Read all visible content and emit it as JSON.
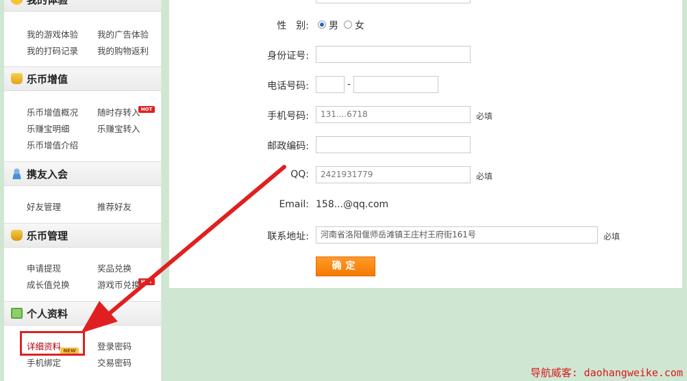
{
  "sidebar": {
    "sections": [
      {
        "title": "我的体验",
        "links": [
          "我的游戏体验",
          "我的广告体验",
          "我的打码记录",
          "我的购物返利"
        ]
      },
      {
        "title": "乐币增值",
        "links": [
          "乐币增值概况",
          "随时存转入",
          "乐赚宝明细",
          "乐赚宝转入",
          "乐币增值介绍"
        ]
      },
      {
        "title": "携友入会",
        "links": [
          "好友管理",
          "推荐好友"
        ]
      },
      {
        "title": "乐币管理",
        "links": [
          "申请提现",
          "奖品兑换",
          "成长值兑换",
          "游戏币兑换"
        ]
      },
      {
        "title": "个人资料",
        "links": [
          "详细资料",
          "登录密码",
          "手机绑定",
          "交易密码"
        ]
      }
    ],
    "hot_badge": "HOT",
    "new_badge": "NEW"
  },
  "form": {
    "gender_label": "性　别:",
    "gender_male": "男",
    "gender_female": "女",
    "gender_selected": "男",
    "id_label": "身份证号:",
    "id_value": "",
    "tel_label": "电话号码:",
    "tel_separator": "-",
    "mobile_label": "手机号码:",
    "mobile_value": "131....6718",
    "mobile_note": "必填",
    "postcode_label": "邮政编码:",
    "postcode_value": "",
    "qq_label": "QQ:",
    "qq_value": "2421931779",
    "qq_note": "必填",
    "email_label": "Email:",
    "email_value": "158...@qq.com",
    "address_label": "联系地址:",
    "address_value": "河南省洛阳偃师岳滩镇王庄村王府街161号",
    "address_note": "必填",
    "submit_label": "确定"
  },
  "watermark": "导航威客: daohangweike.com",
  "colors": {
    "annotation": "#e02020",
    "button": "#f47a00",
    "page_bg": "#cfe6d3"
  }
}
